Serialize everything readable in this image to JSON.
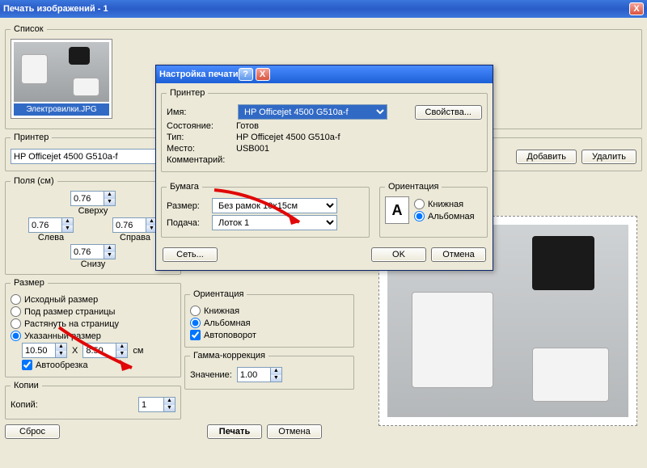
{
  "window": {
    "title": "Печать изображений - 1",
    "close_x": "X"
  },
  "list": {
    "legend": "Список",
    "thumb_caption": "Электровилки.JPG"
  },
  "printer_sec": {
    "legend": "Принтер",
    "value": "HP Officejet 4500 G510a-f",
    "add_btn": "Добавить",
    "del_btn": "Удалить"
  },
  "margins": {
    "legend": "Поля (см)",
    "top": "0.76",
    "left": "0.76",
    "right": "0.76",
    "bottom": "0.76",
    "top_l": "Сверху",
    "left_l": "Слева",
    "right_l": "Справа",
    "bottom_l": "Снизу"
  },
  "size": {
    "legend": "Размер",
    "opt1": "Исходный размер",
    "opt2": "Под размер страницы",
    "opt3": "Растянуть на страницу",
    "opt4": "Указанный размер",
    "w": "10.50",
    "x": "X",
    "h": "8.50",
    "unit": "см",
    "autocrop": "Автообрезка",
    "autocrop_checked": true
  },
  "copies": {
    "legend": "Копии",
    "label": "Копий:",
    "val": "1"
  },
  "orientation_bg": {
    "legend": "Ориентация",
    "opt1": "Книжная",
    "opt2": "Альбомная",
    "autorotate": "Автоповорот"
  },
  "gamma": {
    "legend": "Гамма-коррекция",
    "label": "Значение:",
    "val": "1.00"
  },
  "bottom": {
    "reset": "Сброс",
    "print": "Печать",
    "cancel": "Отмена"
  },
  "dialog": {
    "title": "Настройка печати",
    "help": "?",
    "close": "X",
    "printer": {
      "legend": "Принтер",
      "name_l": "Имя:",
      "name_v": "HP Officejet 4500 G510a-f",
      "props_btn": "Свойства...",
      "state_l": "Состояние:",
      "state_v": "Готов",
      "type_l": "Тип:",
      "type_v": "HP Officejet 4500 G510a-f",
      "where_l": "Место:",
      "where_v": "USB001",
      "comment_l": "Комментарий:"
    },
    "paper": {
      "legend": "Бумага",
      "size_l": "Размер:",
      "size_v": "Без рамок 10x15см",
      "source_l": "Подача:",
      "source_v": "Лоток 1"
    },
    "orient": {
      "legend": "Ориентация",
      "portrait": "Книжная",
      "landscape": "Альбомная"
    },
    "net_btn": "Сеть...",
    "ok": "OK",
    "cancel": "Отмена"
  }
}
